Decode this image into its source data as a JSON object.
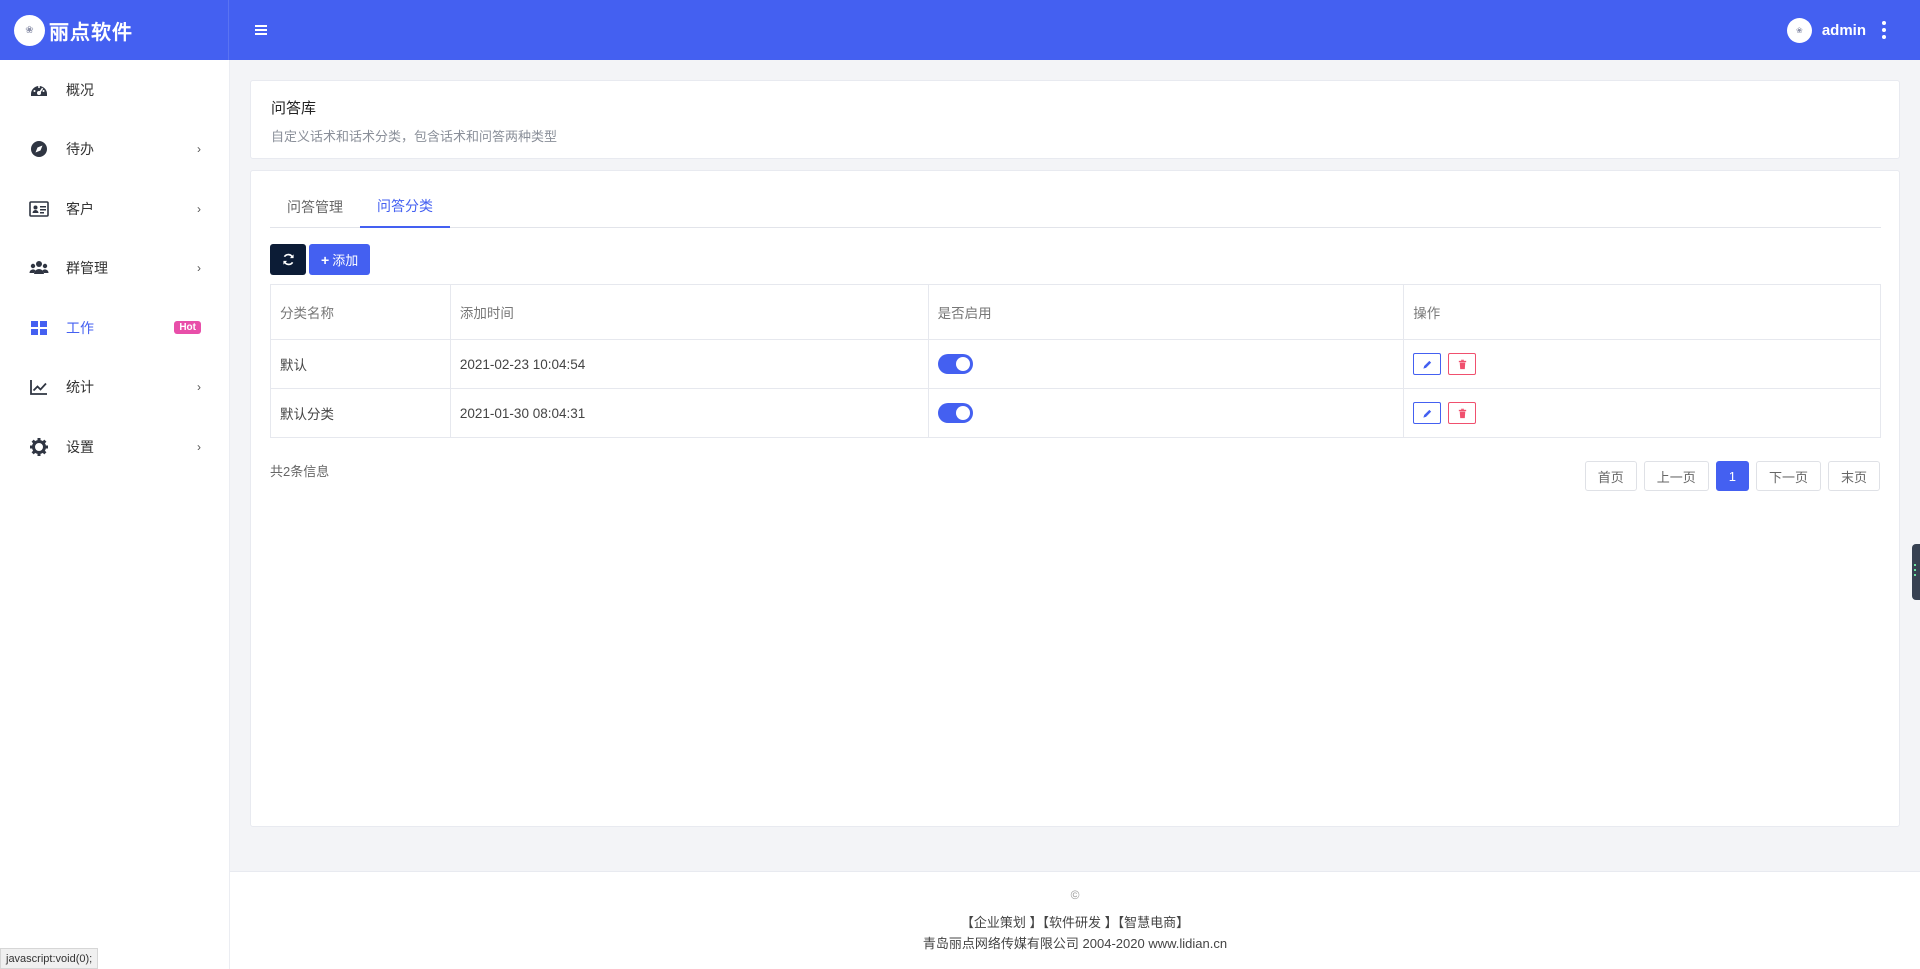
{
  "header": {
    "brand_name": "丽点软件",
    "username": "admin"
  },
  "sidebar": {
    "items": [
      {
        "label": "概况",
        "icon": "dashboard-icon"
      },
      {
        "label": "待办",
        "icon": "compass-icon"
      },
      {
        "label": "客户",
        "icon": "id-card-icon"
      },
      {
        "label": "群管理",
        "icon": "users-icon"
      },
      {
        "label": "工作",
        "icon": "grid-icon",
        "badge": "Hot"
      },
      {
        "label": "统计",
        "icon": "chart-line-icon"
      },
      {
        "label": "设置",
        "icon": "gear-icon"
      }
    ]
  },
  "page": {
    "title": "问答库",
    "description": "自定义话术和话术分类，包含话术和问答两种类型"
  },
  "tabs": [
    {
      "label": "问答管理"
    },
    {
      "label": "问答分类"
    }
  ],
  "toolbar": {
    "add_label": "添加"
  },
  "table": {
    "columns": [
      "分类名称",
      "添加时间",
      "是否启用",
      "操作"
    ],
    "rows": [
      {
        "name": "默认",
        "time": "2021-02-23 10:04:54",
        "enabled": true
      },
      {
        "name": "默认分类",
        "time": "2021-01-30 08:04:31",
        "enabled": true
      }
    ]
  },
  "pagination": {
    "total_text": "共2条信息",
    "first": "首页",
    "prev": "上一页",
    "current": "1",
    "next": "下一页",
    "last": "末页"
  },
  "footer": {
    "copyright": "©",
    "links": "【企业策划 】【软件研发 】【智慧电商】",
    "company": "青岛丽点网络传媒有限公司 2004-2020 www.lidian.cn"
  },
  "statusbar": {
    "text": "javascript:void(0);"
  },
  "colors": {
    "accent": "#4460f1",
    "hot_badge": "#e84fa9",
    "danger": "#f0506e"
  }
}
